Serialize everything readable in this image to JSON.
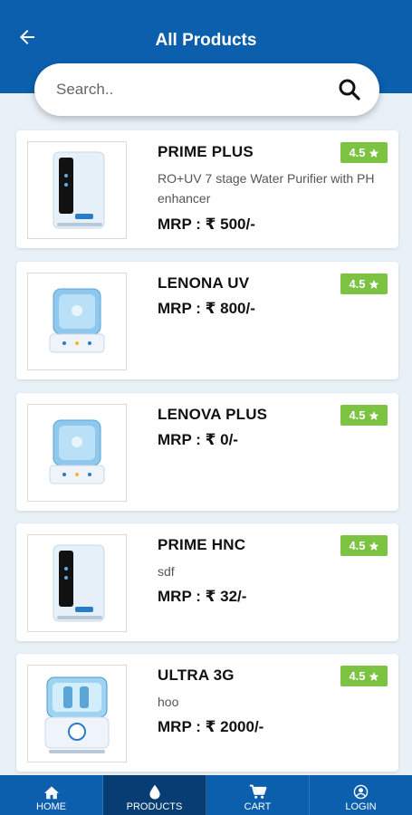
{
  "header": {
    "title": "All Products"
  },
  "search": {
    "placeholder": "Search.."
  },
  "products": [
    {
      "name": "PRIME PLUS",
      "description": "RO+UV 7 stage Water Purifier with PH enhancer",
      "price": "MRP :  ₹ 500/-",
      "rating": "4.5",
      "image": "dark-front-purifier"
    },
    {
      "name": "LENONA UV",
      "description": "",
      "price": "MRP :  ₹ 800/-",
      "rating": "4.5",
      "image": "blue-tank-purifier"
    },
    {
      "name": "LENOVA PLUS",
      "description": "",
      "price": "MRP :  ₹ 0/-",
      "rating": "4.5",
      "image": "blue-tank-purifier"
    },
    {
      "name": "PRIME HNC",
      "description": "sdf",
      "price": "MRP :  ₹ 32/-",
      "rating": "4.5",
      "image": "dark-front-purifier"
    },
    {
      "name": "ULTRA 3G",
      "description": "hoo",
      "price": "MRP :  ₹ 2000/-",
      "rating": "4.5",
      "image": "clear-tank-purifier"
    }
  ],
  "nav": [
    {
      "label": "HOME",
      "icon": "home-icon",
      "active": false
    },
    {
      "label": "PRODUCTS",
      "icon": "water-drop-icon",
      "active": true
    },
    {
      "label": "CART",
      "icon": "cart-icon",
      "active": false
    },
    {
      "label": "LOGIN",
      "icon": "user-icon",
      "active": false
    }
  ],
  "colors": {
    "primary": "#0c5fad",
    "rating": "#7cc243",
    "active_nav": "#073d72"
  }
}
